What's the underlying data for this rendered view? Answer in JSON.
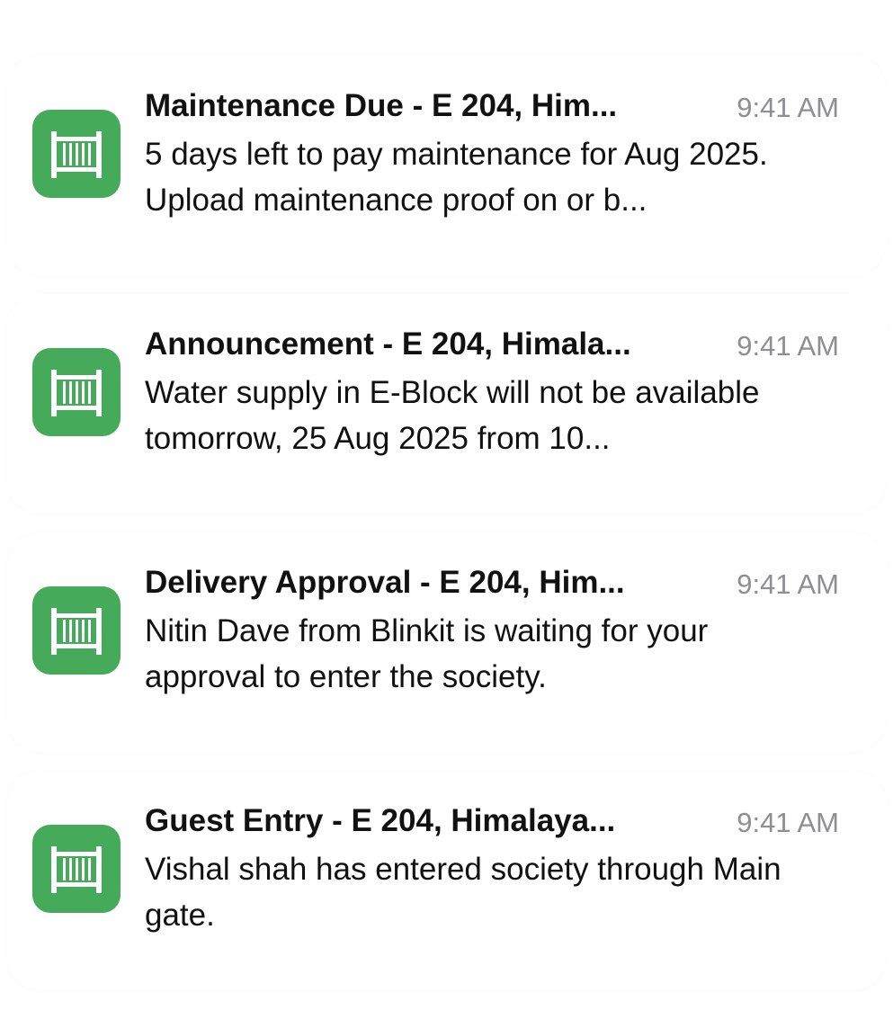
{
  "notifications": [
    {
      "title": "Maintenance Due - E 204, Him...",
      "time": "9:41 AM",
      "body": "5 days left to pay maintenance for Aug 2025. Upload maintenance proof on or b...",
      "icon": "gate-icon"
    },
    {
      "title": "Announcement - E 204, Himala...",
      "time": "9:41 AM",
      "body": "Water supply in E-Block will not be available tomorrow, 25 Aug 2025 from 10...",
      "icon": "gate-icon"
    },
    {
      "title": "Delivery Approval - E 204, Him...",
      "time": "9:41 AM",
      "body": "Nitin Dave from Blinkit is waiting for your approval to enter the society.",
      "icon": "gate-icon"
    },
    {
      "title": "Guest Entry - E 204, Himalaya...",
      "time": "9:41 AM",
      "body": "Vishal shah has entered society through Main gate.",
      "icon": "gate-icon"
    }
  ],
  "colors": {
    "icon_bg": "#45aa5a",
    "title": "#111111",
    "time": "#8e8e93"
  }
}
